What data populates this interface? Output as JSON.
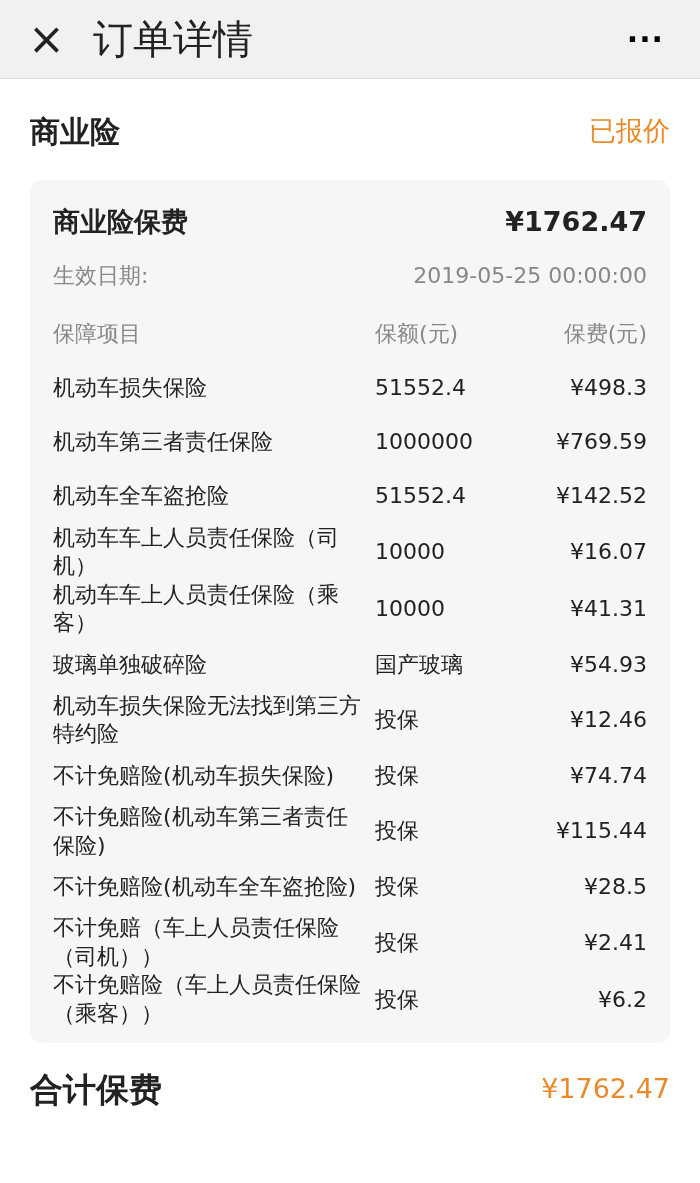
{
  "header": {
    "close": "×",
    "title": "订单详情",
    "more": "···"
  },
  "section": {
    "title": "商业险",
    "status": "已报价"
  },
  "card": {
    "title": "商业险保费",
    "total": "¥1762.47",
    "date_label": "生效日期:",
    "date": "2019-05-25 00:00:00",
    "columns": [
      "保障项目",
      "保额(元)",
      "保费(元)"
    ],
    "rows": [
      {
        "item": "机动车损失保险",
        "amount": "51552.4",
        "premium": "¥498.3"
      },
      {
        "item": "机动车第三者责任保险",
        "amount": "1000000",
        "premium": "¥769.59"
      },
      {
        "item": "机动车全车盗抢险",
        "amount": "51552.4",
        "premium": "¥142.52"
      },
      {
        "item": "机动车车上人员责任保险（司机）",
        "amount": "10000",
        "premium": "¥16.07"
      },
      {
        "item": "机动车车上人员责任保险（乘客）",
        "amount": "10000",
        "premium": "¥41.31"
      },
      {
        "item": "玻璃单独破碎险",
        "amount": "国产玻璃",
        "premium": "¥54.93"
      },
      {
        "item": "机动车损失保险无法找到第三方特约险",
        "amount": "投保",
        "premium": "¥12.46"
      },
      {
        "item": "不计免赔险(机动车损失保险)",
        "amount": "投保",
        "premium": "¥74.74"
      },
      {
        "item": "不计免赔险(机动车第三者责任保险)",
        "amount": "投保",
        "premium": "¥115.44"
      },
      {
        "item": "不计免赔险(机动车全车盗抢险)",
        "amount": "投保",
        "premium": "¥28.5"
      },
      {
        "item": "不计免赔（车上人员责任保险（司机））",
        "amount": "投保",
        "premium": "¥2.41"
      },
      {
        "item": "不计免赔险（车上人员责任保险（乘客））",
        "amount": "投保",
        "premium": "¥6.2"
      }
    ]
  },
  "footer": {
    "label": "合计保费",
    "total": "¥1762.47"
  }
}
